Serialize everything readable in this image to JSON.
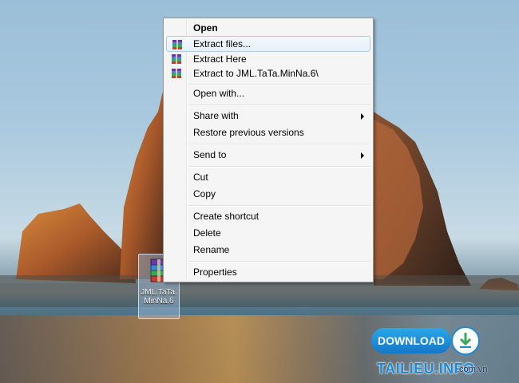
{
  "desktop": {
    "file_icon": {
      "label": "JML.TaTa.MinNa.6",
      "icon": "winrar-archive-icon"
    }
  },
  "context_menu": {
    "items": [
      {
        "label": "Open",
        "bold": true
      },
      {
        "label": "Extract files...",
        "icon": "winrar-icon",
        "highlighted": true
      },
      {
        "label": "Extract Here",
        "icon": "winrar-icon"
      },
      {
        "label": "Extract to JML.TaTa.MinNa.6\\",
        "icon": "winrar-icon"
      },
      {
        "label": "Open with..."
      },
      {
        "label": "Share with",
        "submenu": true
      },
      {
        "label": "Restore previous versions"
      },
      {
        "label": "Send to",
        "submenu": true
      },
      {
        "label": "Cut"
      },
      {
        "label": "Copy"
      },
      {
        "label": "Create shortcut"
      },
      {
        "label": "Delete"
      },
      {
        "label": "Rename"
      },
      {
        "label": "Properties"
      }
    ]
  },
  "watermark": {
    "download_label": "DOWNLOAD",
    "brand": "TAILIEU.INFO",
    "domain_suffix": ".com.vn",
    "accent": "#1a8ad8"
  }
}
